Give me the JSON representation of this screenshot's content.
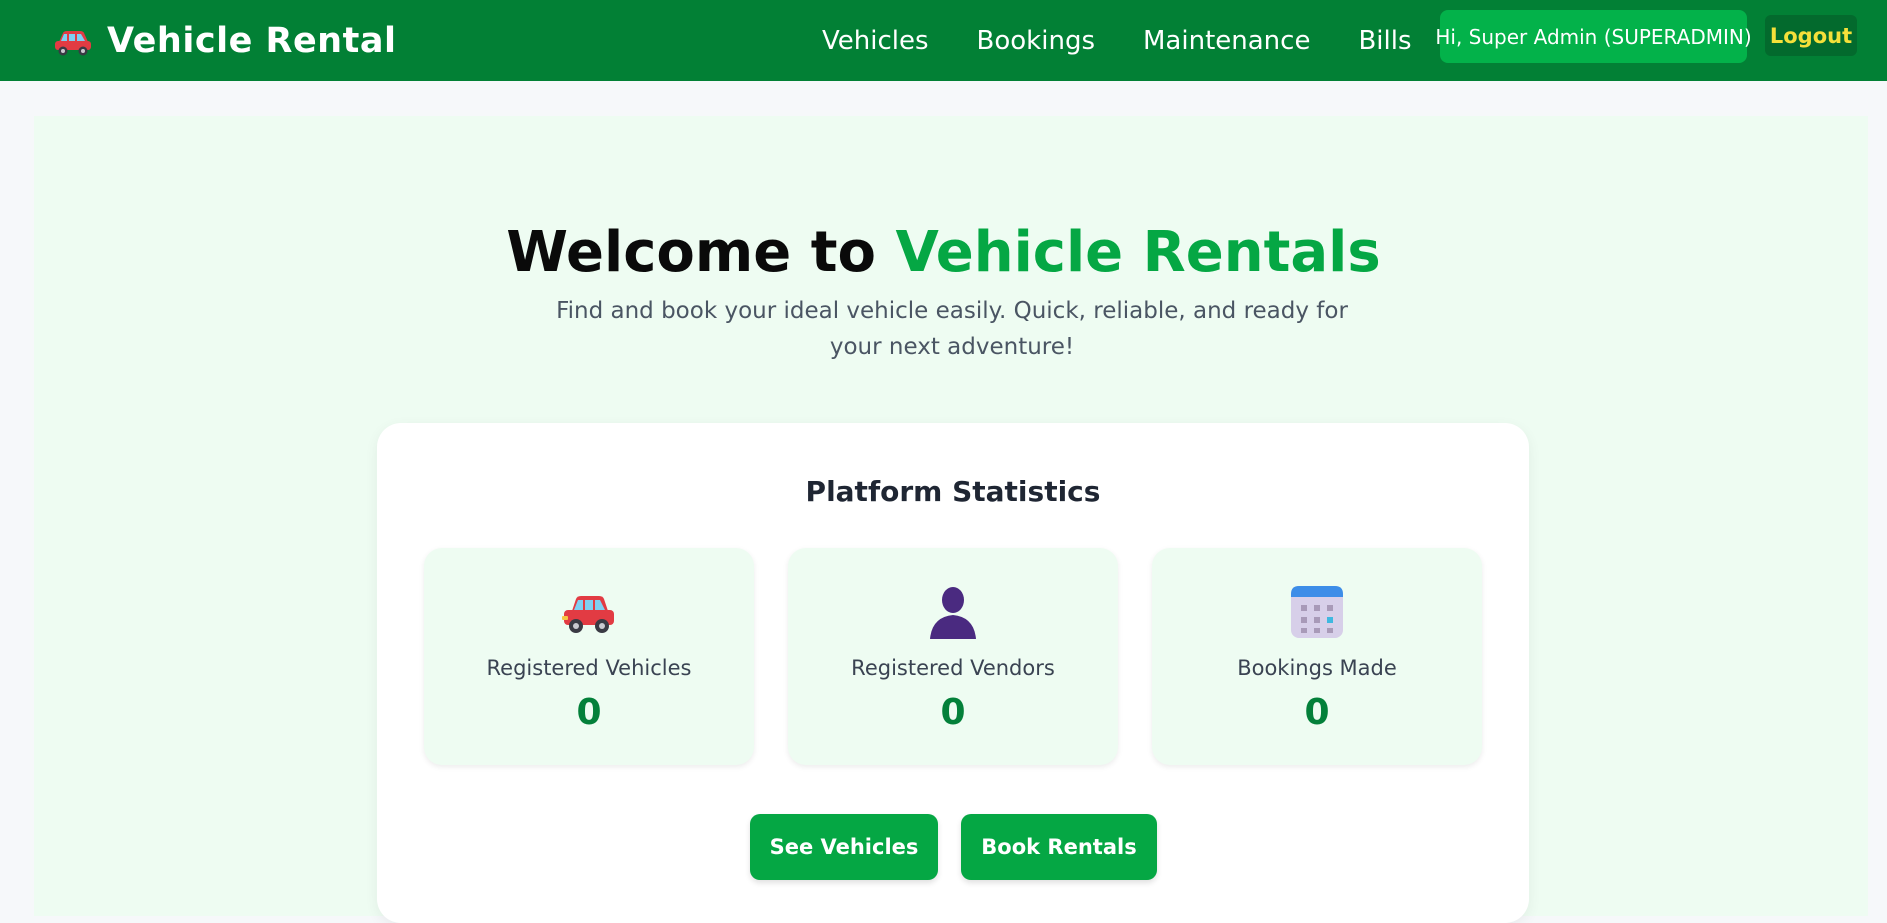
{
  "header": {
    "brand": "Vehicle Rental",
    "nav": [
      "Vehicles",
      "Bookings",
      "Maintenance",
      "Bills"
    ],
    "greeting": "Hi, Super Admin (SUPERADMIN)",
    "logout_label": "Logout"
  },
  "hero": {
    "title_prefix": "Welcome to ",
    "title_accent": "Vehicle Rentals",
    "subtitle": "Find and book your ideal vehicle easily. Quick, reliable, and ready for your next adventure!"
  },
  "stats": {
    "title": "Platform Statistics",
    "items": [
      {
        "icon": "car-icon",
        "label": "Registered Vehicles",
        "value": "0"
      },
      {
        "icon": "person-icon",
        "label": "Registered Vendors",
        "value": "0"
      },
      {
        "icon": "calendar-icon",
        "label": "Bookings Made",
        "value": "0"
      }
    ]
  },
  "actions": {
    "see_vehicles": "See Vehicles",
    "book_rentals": "Book Rentals"
  },
  "colors": {
    "header_bg": "#028035",
    "accent": "#05a744",
    "stat_value": "#03803a",
    "logout_text": "#f5e03a"
  }
}
